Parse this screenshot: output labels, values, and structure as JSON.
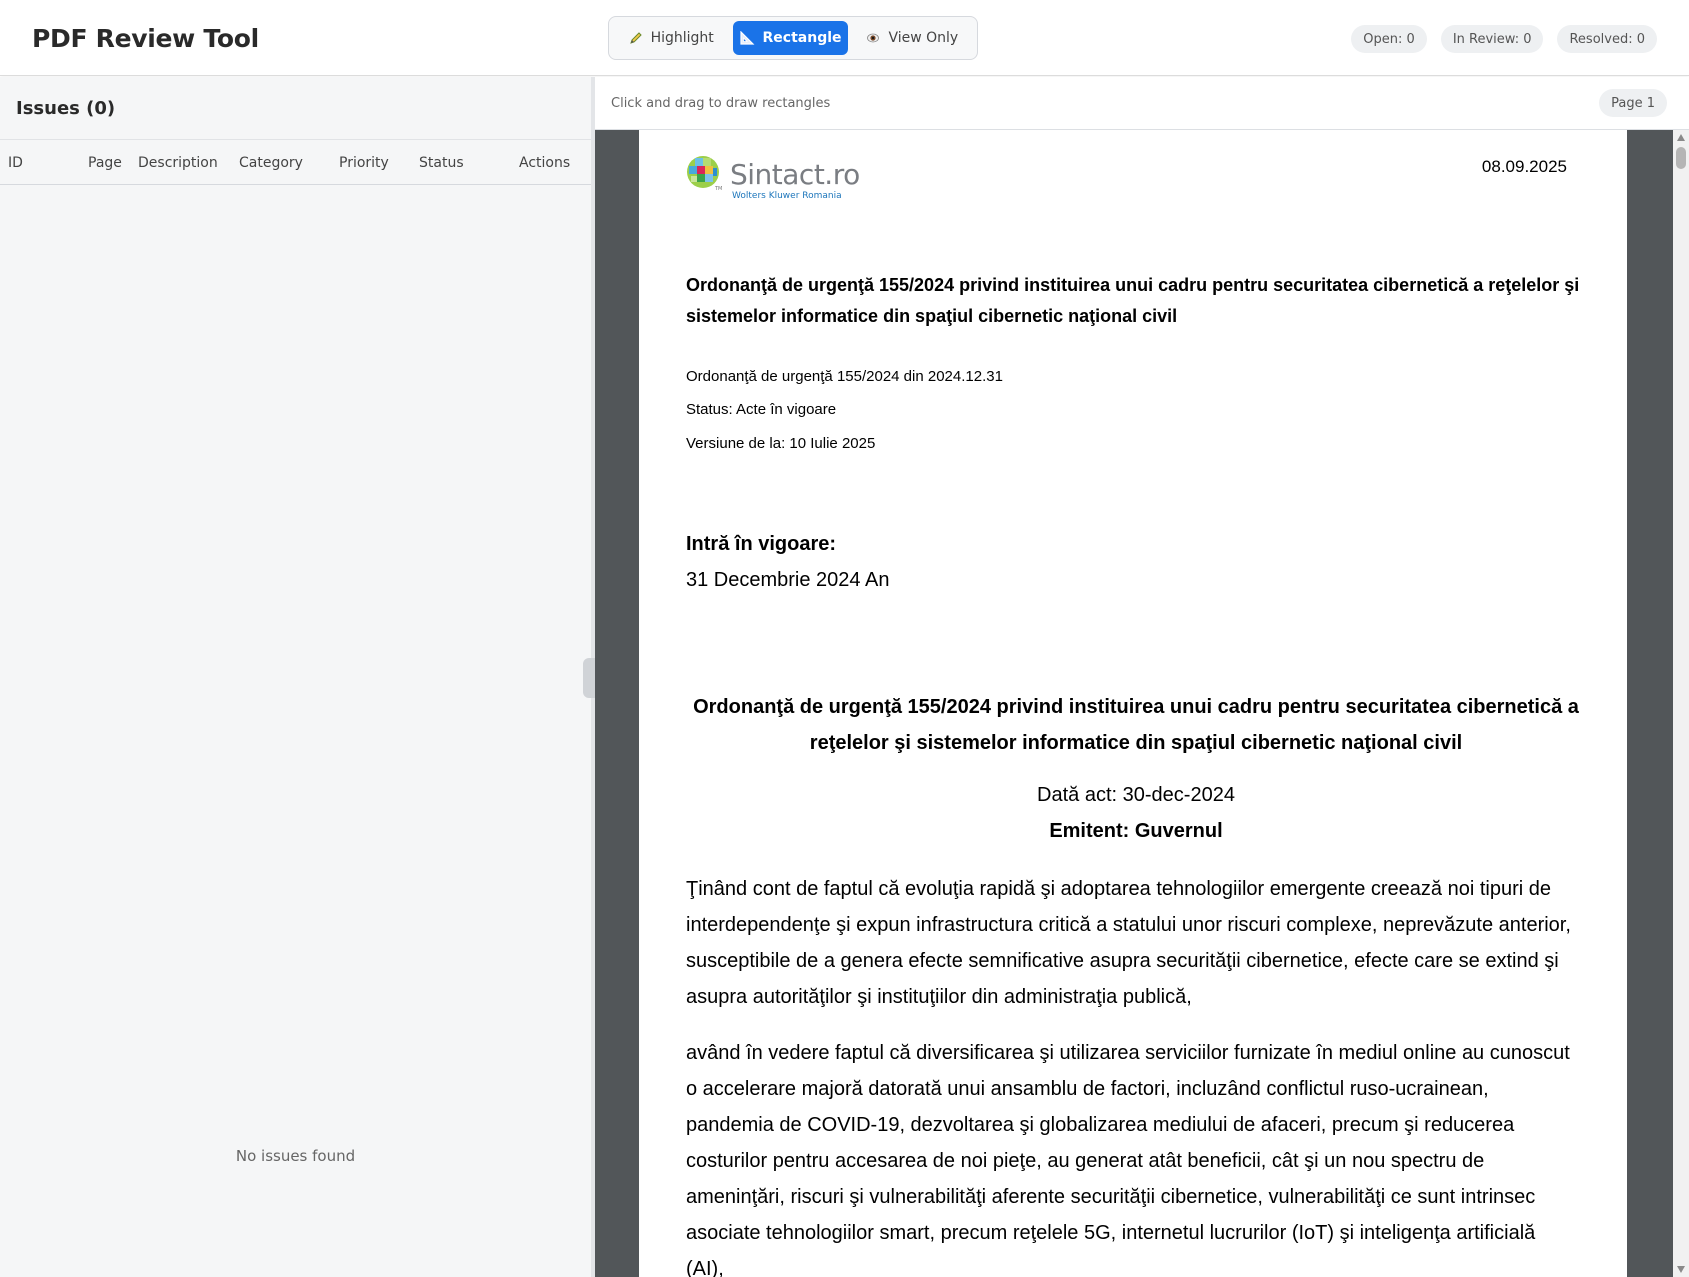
{
  "header": {
    "title": "PDF Review Tool",
    "modes": {
      "highlight": {
        "label": "Highlight",
        "icon": "pencil-icon"
      },
      "rectangle": {
        "label": "Rectangle",
        "icon": "triangle-ruler-icon",
        "active": true
      },
      "view_only": {
        "label": "View Only",
        "icon": "eye-icon"
      }
    },
    "counters": {
      "open": "Open: 0",
      "in_review": "In Review: 0",
      "resolved": "Resolved: 0"
    }
  },
  "issues_panel": {
    "title": "Issues (0)",
    "columns": [
      "ID",
      "Page",
      "Description",
      "Category",
      "Priority",
      "Status",
      "Actions"
    ],
    "empty_message": "No issues found"
  },
  "viewer": {
    "instruction": "Click and drag to draw rectangles",
    "page_label": "Page 1"
  },
  "document": {
    "logo_name": "Sintact.ro",
    "logo_tm": "TM",
    "logo_sub": "Wolters Kluwer Romania",
    "date": "08.09.2025",
    "title": "Ordonanţă de urgenţă 155/2024 privind instituirea unui cadru pentru securitatea cibernetică a reţelelor şi sistemelor informatice din spaţiul cibernetic naţional civil",
    "meta_act": "Ordonanţă de urgenţă 155/2024 din 2024.12.31",
    "meta_status": "Status: Acte în vigoare",
    "meta_version": "Versiune de la: 10 Iulie 2025",
    "in_force_label": "Intră în vigoare:",
    "in_force_value": "31 Decembrie 2024 An",
    "title_centered": "Ordonanţă de urgenţă 155/2024 privind instituirea unui cadru pentru securitatea cibernetică a reţelelor şi sistemelor informatice din spaţiul cibernetic naţional civil",
    "act_date": "Dată act: 30-dec-2024",
    "emitent": "Emitent: Guvernul",
    "paragraph_1": "Ţinând cont de faptul că evoluţia rapidă şi adoptarea tehnologiilor emergente creează noi tipuri de interdependenţe şi expun infrastructura critică a statului unor riscuri complexe, neprevăzute anterior, susceptibile de a genera efecte semnificative asupra securităţii cibernetice, efecte care se extind şi asupra autorităţilor şi instituţiilor din administraţia publică,",
    "paragraph_2": "având în vedere faptul că diversificarea şi utilizarea serviciilor furnizate în mediul online au cunoscut o accelerare majoră datorată unui ansamblu de factori, incluzând conflictul ruso-ucrainean, pandemia de COVID-19, dezvoltarea şi globalizarea mediului de afaceri, precum şi reducerea costurilor pentru accesarea de noi pieţe, au generat atât beneficii, cât şi un nou spectru de ameninţări, riscuri şi vulnerabilităţi aferente securităţii cibernetice, vulnerabilităţi ce sunt intrinsec asociate tehnologiilor smart, precum reţelele 5G, internetul lucrurilor (IoT) şi inteligenţa artificială (AI),"
  },
  "colors": {
    "accent": "#1a73e8",
    "viewer_background": "#525659",
    "panel_background": "#f5f6f7",
    "logo_blue": "#1d76bb"
  }
}
